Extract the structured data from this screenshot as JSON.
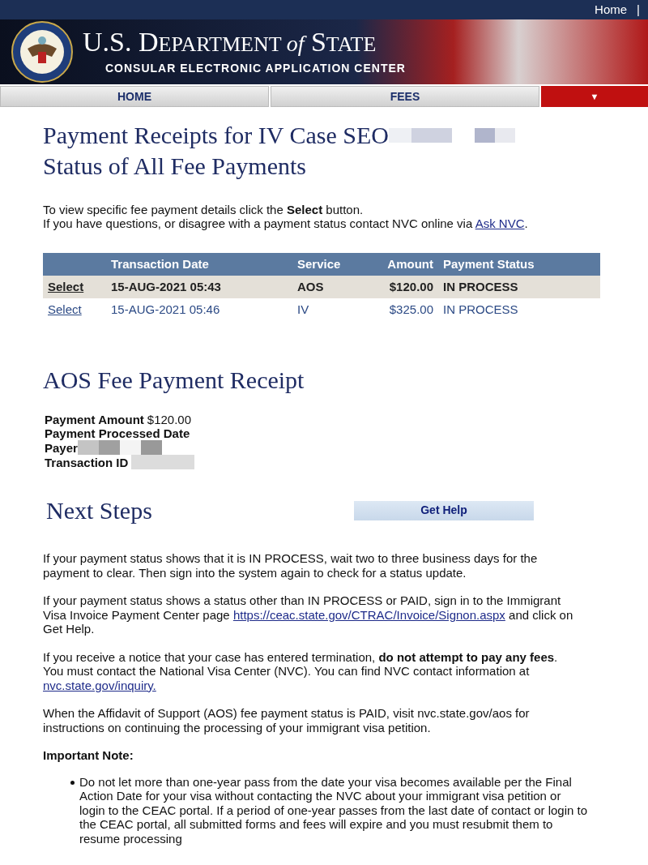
{
  "top_bar": {
    "link": "Home",
    "separator": "|"
  },
  "banner": {
    "title_parts": [
      "U.S. D",
      "EPARTMENT ",
      "of",
      " S",
      "TATE"
    ],
    "subtitle": "CONSULAR ELECTRONIC APPLICATION CENTER"
  },
  "nav": {
    "tabs": [
      {
        "label": "HOME",
        "kind": "tab"
      },
      {
        "label": "FEES",
        "kind": "tab"
      },
      {
        "label": "▼",
        "kind": "menu"
      }
    ]
  },
  "page_title": [
    "Payment Receipts for IV Case SEO",
    "Status of All Fee Payments"
  ],
  "intro": [
    "To view specific fee payment details click the **Select** button.",
    "If you have questions, or disagree with a payment status contact NVC online via"
  ],
  "intro_link": "Ask NVC",
  "intro_end": ".",
  "table": {
    "columns": [
      null,
      "Transaction Date",
      "Service",
      "Amount",
      "Payment Status"
    ],
    "rows": [
      {
        "action": "Select",
        "date": "15-AUG-2021 05:43",
        "service": "AOS",
        "amount": "$120.00",
        "status": "IN PROCESS",
        "selected": true
      },
      {
        "action": "Select",
        "date": "15-AUG-2021 05:46",
        "service": "IV",
        "amount": "$325.00",
        "status": "IN PROCESS",
        "selected": false
      }
    ]
  },
  "receipt": {
    "title": "AOS Fee Payment Receipt",
    "fields": [
      {
        "label": "Payment Amount",
        "value": "$120.00"
      },
      {
        "label": "Payment Processed Date"
      },
      {
        "label": "Payer"
      },
      {
        "label": "Transaction ID"
      }
    ]
  },
  "next_steps": {
    "title": "Next Steps",
    "button": "Get Help",
    "paragraphs": [
      {
        "text": "If your payment status shows that it is IN PROCESS, wait two to three business days for the payment to clear. Then sign into the system again to check for a status update."
      },
      {
        "text": "If your payment status shows a status other than IN PROCESS or PAID, sign in to the Immigrant Visa Invoice Payment Center page",
        "link": "https://ceac.state.gov/CTRAC/Invoice/Signon.aspx",
        "after": " and click on Get Help."
      },
      {
        "text": "If you receive a notice that your case has entered termination, **do not attempt to pay any fees**. You must contact the National Visa Center (NVC). You can find NVC contact information at",
        "link": "nvc.state.gov/inquiry."
      },
      {
        "text": "When the Affidavit of Support (AOS) fee payment status is PAID, visit nvc.state.gov/aos for instructions on continuing the processing of your immigrant visa petition."
      }
    ],
    "note_title": "Important Note:",
    "bullets": [
      "Do not let more than one-year pass from the date your visa becomes available per the Final Action Date for your visa without contacting the NVC about your immigrant visa petition or login to the CEAC portal. If a period of one-year passes from the last date of contact or login to the CEAC portal, all submitted forms and fees will expire and you must resubmit them to resume processing"
    ]
  }
}
